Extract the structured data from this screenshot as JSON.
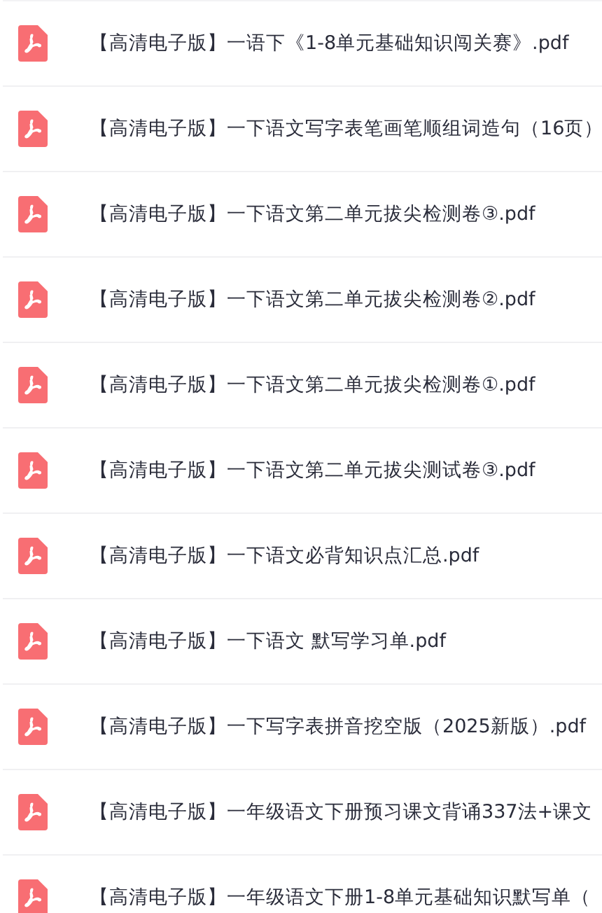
{
  "files": [
    {
      "name": "【高清电子版】一语下《1-8单元基础知识闯关赛》.pdf",
      "kind": "pdf"
    },
    {
      "name": "【高清电子版】一下语文写字表笔画笔顺组词造句（16页）",
      "kind": "pdf"
    },
    {
      "name": "【高清电子版】一下语文第二单元拔尖检测卷③.pdf",
      "kind": "pdf"
    },
    {
      "name": "【高清电子版】一下语文第二单元拔尖检测卷②.pdf",
      "kind": "pdf"
    },
    {
      "name": "【高清电子版】一下语文第二单元拔尖检测卷①.pdf",
      "kind": "pdf"
    },
    {
      "name": "【高清电子版】一下语文第二单元拔尖测试卷③.pdf",
      "kind": "pdf"
    },
    {
      "name": "【高清电子版】一下语文必背知识点汇总.pdf",
      "kind": "pdf"
    },
    {
      "name": "【高清电子版】一下语文 默写学习单.pdf",
      "kind": "pdf"
    },
    {
      "name": "【高清电子版】一下写字表拼音挖空版（2025新版）.pdf",
      "kind": "pdf"
    },
    {
      "name": "【高清电子版】一年级语文下册预习课文背诵337法+课文",
      "kind": "pdf"
    },
    {
      "name": "【高清电子版】一年级语文下册1-8单元基础知识默写单（",
      "kind": "pdf"
    }
  ]
}
